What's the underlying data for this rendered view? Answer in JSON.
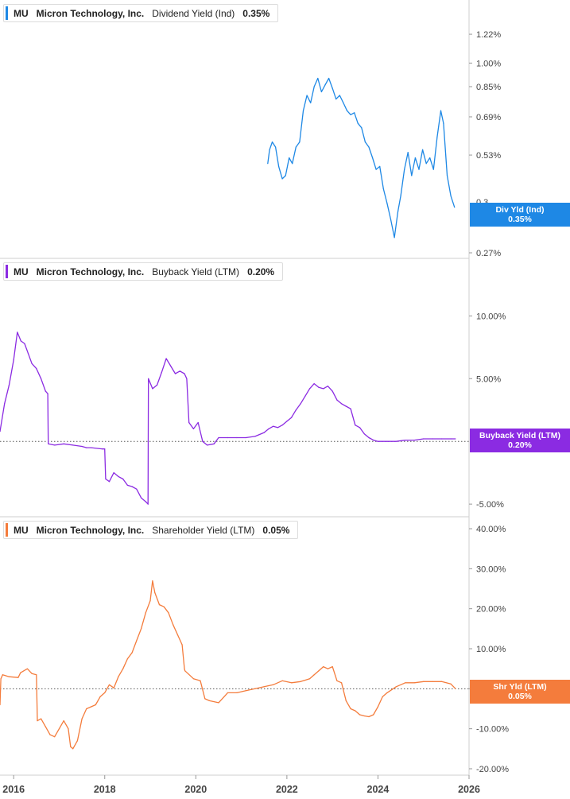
{
  "colors": {
    "dividend": "#1e88e5",
    "buyback": "#8b2be2",
    "shareholder": "#f47c3c",
    "divider": "#cfcfcf",
    "zero_line": "#555555"
  },
  "x_axis": {
    "ticks": [
      "2016",
      "2018",
      "2020",
      "2022",
      "2024",
      "2026"
    ],
    "range": [
      2015.7,
      2026.0
    ]
  },
  "panels": [
    {
      "legend": {
        "ticker": "MU",
        "company": "Micron Technology, Inc.",
        "metric": "Dividend Yield (Ind)",
        "value": "0.35%"
      },
      "value_tag": {
        "line1": "Div Yld (Ind)",
        "line2": "0.35%"
      },
      "y_ticks": [
        "1.22%",
        "1.00%",
        "0.85%",
        "0.69%",
        "0.53%",
        "0.27%"
      ],
      "y_tick_values": [
        1.22,
        1.0,
        0.85,
        0.69,
        0.53,
        0.27
      ],
      "overlap_ticks": [
        "0.3",
        "0.32"
      ]
    },
    {
      "legend": {
        "ticker": "MU",
        "company": "Micron Technology, Inc.",
        "metric": "Buyback Yield (LTM)",
        "value": "0.20%"
      },
      "value_tag": {
        "line1": "Buyback Yield (LTM)",
        "line2": "0.20%"
      },
      "y_ticks": [
        "10.00%",
        "5.00%",
        "-5.00%"
      ],
      "y_tick_values": [
        10,
        5,
        -5
      ]
    },
    {
      "legend": {
        "ticker": "MU",
        "company": "Micron Technology, Inc.",
        "metric": "Shareholder Yield (LTM)",
        "value": "0.05%"
      },
      "value_tag": {
        "line1": "Shr Yld (LTM)",
        "line2": "0.05%"
      },
      "y_ticks": [
        "40.00%",
        "30.00%",
        "20.00%",
        "10.00%",
        "0.00%",
        "-10.00%",
        "-20.00%"
      ],
      "y_tick_values": [
        40,
        30,
        20,
        10,
        0,
        -10,
        -20
      ]
    }
  ],
  "chart_data": [
    {
      "type": "line",
      "title": "Dividend Yield (Ind)",
      "series": [
        {
          "name": "Dividend Yield (Ind)",
          "x": [
            2021.58,
            2021.62,
            2021.68,
            2021.75,
            2021.82,
            2021.9,
            2021.97,
            2022.05,
            2022.12,
            2022.2,
            2022.28,
            2022.36,
            2022.44,
            2022.52,
            2022.6,
            2022.68,
            2022.76,
            2022.84,
            2022.92,
            2023.0,
            2023.08,
            2023.16,
            2023.24,
            2023.32,
            2023.4,
            2023.48,
            2023.56,
            2023.64,
            2023.72,
            2023.8,
            2023.88,
            2023.96,
            2024.04,
            2024.12,
            2024.2,
            2024.28,
            2024.36,
            2024.44,
            2024.5,
            2024.58,
            2024.66,
            2024.74,
            2024.82,
            2024.9,
            2024.98,
            2025.06,
            2025.14,
            2025.22,
            2025.3,
            2025.38,
            2025.44,
            2025.52,
            2025.6,
            2025.68
          ],
          "values": [
            0.5,
            0.55,
            0.58,
            0.56,
            0.49,
            0.45,
            0.46,
            0.52,
            0.5,
            0.56,
            0.58,
            0.72,
            0.8,
            0.76,
            0.85,
            0.9,
            0.82,
            0.86,
            0.9,
            0.84,
            0.78,
            0.8,
            0.76,
            0.72,
            0.7,
            0.71,
            0.66,
            0.64,
            0.58,
            0.56,
            0.52,
            0.48,
            0.49,
            0.42,
            0.38,
            0.34,
            0.3,
            0.36,
            0.4,
            0.48,
            0.54,
            0.46,
            0.52,
            0.48,
            0.55,
            0.5,
            0.52,
            0.48,
            0.6,
            0.72,
            0.66,
            0.46,
            0.4,
            0.37
          ]
        }
      ],
      "ylim": [
        0.27,
        1.4
      ],
      "scale": "log"
    },
    {
      "type": "line",
      "title": "Buyback Yield (LTM)",
      "series": [
        {
          "name": "Buyback Yield (LTM)",
          "x": [
            2015.7,
            2015.8,
            2015.9,
            2016.0,
            2016.08,
            2016.16,
            2016.24,
            2016.32,
            2016.4,
            2016.5,
            2016.6,
            2016.7,
            2016.75,
            2016.76,
            2016.9,
            2017.1,
            2017.3,
            2017.5,
            2017.6,
            2017.7,
            2017.95,
            2018.0,
            2018.02,
            2018.1,
            2018.2,
            2018.3,
            2018.4,
            2018.5,
            2018.6,
            2018.7,
            2018.8,
            2018.9,
            2018.95,
            2018.96,
            2019.05,
            2019.15,
            2019.25,
            2019.35,
            2019.45,
            2019.55,
            2019.65,
            2019.75,
            2019.8,
            2019.85,
            2019.95,
            2020.05,
            2020.15,
            2020.25,
            2020.4,
            2020.5,
            2020.7,
            2020.9,
            2021.1,
            2021.3,
            2021.5,
            2021.6,
            2021.7,
            2021.8,
            2021.9,
            2022.0,
            2022.1,
            2022.2,
            2022.3,
            2022.4,
            2022.5,
            2022.6,
            2022.7,
            2022.8,
            2022.9,
            2023.0,
            2023.1,
            2023.2,
            2023.3,
            2023.4,
            2023.5,
            2023.6,
            2023.7,
            2023.8,
            2023.9,
            2024.0,
            2024.2,
            2024.4,
            2024.6,
            2024.8,
            2025.0,
            2025.2,
            2025.4,
            2025.6,
            2025.7
          ],
          "values": [
            0.8,
            3.0,
            4.5,
            6.5,
            8.7,
            8.0,
            7.8,
            7.0,
            6.2,
            5.8,
            5.0,
            4.0,
            3.8,
            -0.2,
            -0.3,
            -0.2,
            -0.3,
            -0.4,
            -0.5,
            -0.5,
            -0.6,
            -0.6,
            -3.0,
            -3.2,
            -2.5,
            -2.8,
            -3.0,
            -3.5,
            -3.6,
            -3.8,
            -4.5,
            -4.8,
            -5.0,
            5.0,
            4.2,
            4.5,
            5.5,
            6.6,
            6.0,
            5.4,
            5.6,
            5.4,
            5.0,
            1.5,
            1.0,
            1.5,
            0.0,
            -0.3,
            -0.2,
            0.3,
            0.3,
            0.3,
            0.3,
            0.4,
            0.7,
            1.0,
            1.2,
            1.1,
            1.3,
            1.6,
            1.9,
            2.5,
            3.0,
            3.6,
            4.2,
            4.6,
            4.3,
            4.2,
            4.4,
            4.0,
            3.3,
            3.0,
            2.8,
            2.6,
            1.3,
            1.1,
            0.6,
            0.3,
            0.1,
            0.0,
            0.0,
            0.0,
            0.1,
            0.1,
            0.2,
            0.2,
            0.2,
            0.2,
            0.2
          ]
        }
      ],
      "ylim": [
        -5.5,
        13.0
      ]
    },
    {
      "type": "line",
      "title": "Shareholder Yield (LTM)",
      "series": [
        {
          "name": "Shareholder Yield (LTM)",
          "x": [
            2015.7,
            2015.72,
            2015.76,
            2015.9,
            2016.1,
            2016.15,
            2016.3,
            2016.4,
            2016.5,
            2016.52,
            2016.6,
            2016.7,
            2016.8,
            2016.9,
            2017.0,
            2017.1,
            2017.2,
            2017.25,
            2017.3,
            2017.4,
            2017.5,
            2017.6,
            2017.7,
            2017.8,
            2017.9,
            2018.0,
            2018.1,
            2018.2,
            2018.3,
            2018.4,
            2018.5,
            2018.6,
            2018.7,
            2018.8,
            2018.9,
            2019.0,
            2019.05,
            2019.1,
            2019.2,
            2019.3,
            2019.4,
            2019.5,
            2019.6,
            2019.7,
            2019.75,
            2019.76,
            2019.95,
            2020.1,
            2020.2,
            2020.3,
            2020.5,
            2020.7,
            2020.9,
            2021.1,
            2021.3,
            2021.5,
            2021.7,
            2021.9,
            2022.1,
            2022.3,
            2022.5,
            2022.6,
            2022.7,
            2022.8,
            2022.9,
            2023.0,
            2023.1,
            2023.2,
            2023.3,
            2023.4,
            2023.5,
            2023.6,
            2023.7,
            2023.8,
            2023.9,
            2024.0,
            2024.1,
            2024.2,
            2024.4,
            2024.6,
            2024.8,
            2025.0,
            2025.2,
            2025.4,
            2025.6,
            2025.7
          ],
          "values": [
            -4.0,
            2.5,
            3.5,
            3.0,
            2.8,
            4.0,
            5.0,
            3.8,
            3.5,
            -8.0,
            -7.5,
            -9.5,
            -11.5,
            -12.0,
            -10.0,
            -8.0,
            -10.0,
            -14.5,
            -15.0,
            -13.0,
            -7.5,
            -5.0,
            -4.5,
            -4.0,
            -2.0,
            -1.0,
            1.0,
            0.2,
            3.0,
            5.0,
            7.5,
            9.0,
            12.0,
            15.0,
            19.0,
            22.0,
            27.0,
            24.0,
            21.0,
            20.5,
            19.0,
            16.0,
            13.5,
            11.0,
            5.0,
            4.5,
            2.5,
            2.0,
            -2.5,
            -3.0,
            -3.5,
            -1.0,
            -1.0,
            -0.5,
            0.0,
            0.5,
            1.0,
            2.0,
            1.5,
            1.8,
            2.5,
            3.5,
            4.5,
            5.5,
            5.0,
            5.5,
            2.0,
            1.5,
            -3.0,
            -5.0,
            -5.5,
            -6.5,
            -6.8,
            -7.0,
            -6.5,
            -4.5,
            -2.0,
            -1.0,
            0.5,
            1.5,
            1.5,
            1.8,
            1.8,
            1.8,
            1.2,
            0.05
          ]
        }
      ],
      "ylim": [
        -21,
        41
      ]
    }
  ]
}
